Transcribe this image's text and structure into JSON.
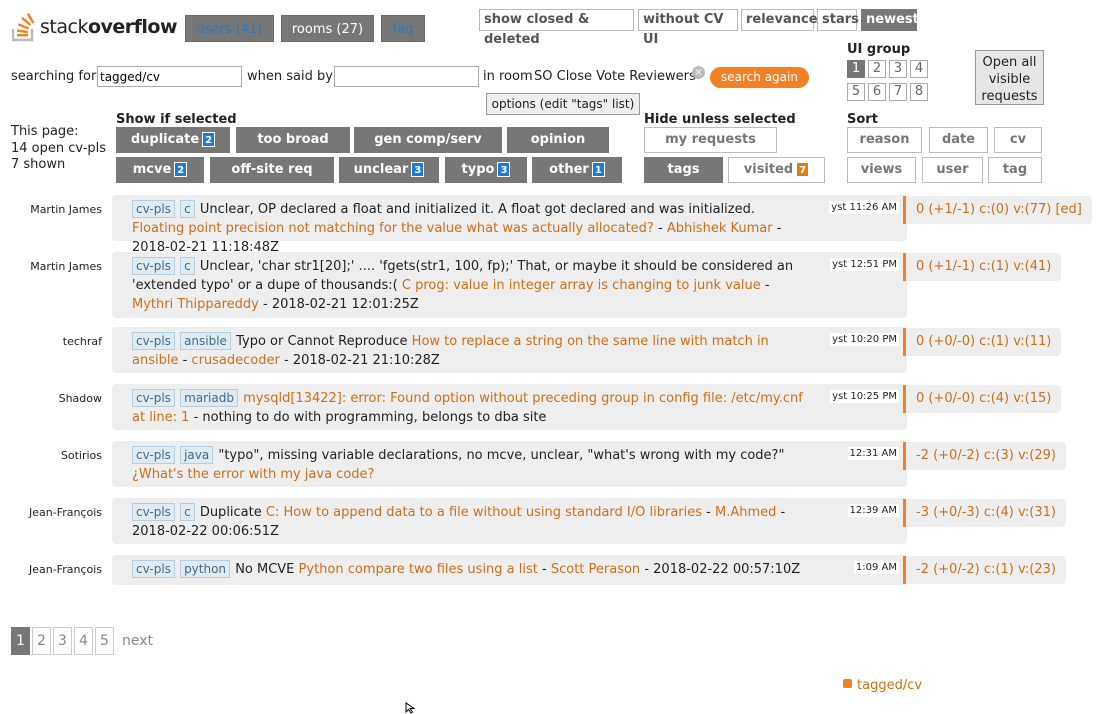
{
  "logo": {
    "text_pre": "stack",
    "text_bold": "overflow"
  },
  "nav": {
    "users": "users (41)",
    "rooms": "rooms (27)",
    "faq": "faq"
  },
  "filters": [
    "show closed & deleted",
    "without CV UI",
    "relevance",
    "stars",
    "newest"
  ],
  "search": {
    "searching_for_label": "searching for",
    "searching_for_value": "tagged/cv",
    "when_said_by_label": "when said by",
    "when_said_by_value": "",
    "in_room_label": "in room",
    "room_name": "SO Close Vote Reviewers",
    "clear": "×",
    "search_again": "search again",
    "options": "options (edit \"tags\" list)"
  },
  "ui_group": {
    "label": "UI group",
    "buttons": [
      "1",
      "2",
      "3",
      "4",
      "5",
      "6",
      "7",
      "8"
    ],
    "active": "1"
  },
  "open_all": "Open all visible requests",
  "this_page": {
    "line1": "This page:",
    "line2": "14 open cv-pls",
    "line3": "7 shown"
  },
  "show_if_selected": {
    "title": "Show if selected",
    "buttons": [
      {
        "label": "duplicate",
        "badge": "2"
      },
      {
        "label": "too broad",
        "badge": ""
      },
      {
        "label": "gen comp/serv",
        "badge": ""
      },
      {
        "label": "opinion",
        "badge": ""
      },
      {
        "label": "mcve",
        "badge": "2"
      },
      {
        "label": "off-site req",
        "badge": ""
      },
      {
        "label": "unclear",
        "badge": "3"
      },
      {
        "label": "typo",
        "badge": "3"
      },
      {
        "label": "other",
        "badge": "1"
      }
    ]
  },
  "hide_unless_selected": {
    "title": "Hide unless selected",
    "my_requests": "my requests",
    "tags": "tags",
    "visited": "visited",
    "visited_badge": "7"
  },
  "sort": {
    "title": "Sort",
    "buttons": [
      "reason",
      "date",
      "cv",
      "views",
      "user",
      "tag"
    ]
  },
  "requests": [
    {
      "user": "Martin James",
      "tags": [
        "cv-pls",
        "c"
      ],
      "text": "Unclear, OP declared a float and initialized it. A float got declared and was initialized.",
      "link": "Floating point precision not matching for the value what was actually allocated?",
      "author": "Abhishek Kumar",
      "date": "2018-02-21 11:18:48Z",
      "time": "yst 11:26 AM",
      "stats": "0 (+1/-1) c:(0) v:(77) [ed]"
    },
    {
      "user": "Martin James",
      "tags": [
        "cv-pls",
        "c"
      ],
      "text": "Unclear, 'char str1[20];' .... 'fgets(str1, 100, fp);' That, or maybe it should be considered an 'extended typo' or a dupe of thousands:(",
      "link": "C prog: value in integer array is changing to junk value",
      "author": "Mythri Thippareddy",
      "date": "2018-02-21 12:01:25Z",
      "time": "yst 12:51 PM",
      "stats": "0 (+1/-1) c:(1) v:(41)"
    },
    {
      "user": "techraf",
      "tags": [
        "cv-pls",
        "ansible"
      ],
      "text": "Typo or Cannot Reproduce",
      "link": "How to replace a string on the same line with match in ansible",
      "author": "crusadecoder",
      "date": "2018-02-21 21:10:28Z",
      "time": "yst 10:20 PM",
      "stats": "0 (+0/-0) c:(1) v:(11)"
    },
    {
      "user": "Shadow",
      "tags": [
        "cv-pls",
        "mariadb"
      ],
      "text": "",
      "link": "mysqld[13422]: error: Found option without preceding group in config file: /etc/my.cnf at line: 1",
      "author": "",
      "date": "",
      "suffix": "nothing to do with programming, belongs to dba site",
      "time": "yst 10:25 PM",
      "stats": "0 (+0/-0) c:(4) v:(15)"
    },
    {
      "user": "Sotirios",
      "tags": [
        "cv-pls",
        "java"
      ],
      "text": "\"typo\", missing variable declarations, no mcve, unclear, \"what's wrong with my code?\"",
      "link": "¿What's the error with my java code?",
      "author": "",
      "date": "",
      "time": "12:31 AM",
      "stats": "-2 (+0/-2) c:(3) v:(29)"
    },
    {
      "user": "Jean-François",
      "tags": [
        "cv-pls",
        "c"
      ],
      "text": "Duplicate",
      "link": "C: How to append data to a file without using standard I/O libraries",
      "author": "M.Ahmed",
      "date": "2018-02-22 00:06:51Z",
      "time": "12:39 AM",
      "stats": "-3 (+0/-3) c:(4) v:(31)"
    },
    {
      "user": "Jean-François",
      "tags": [
        "cv-pls",
        "python"
      ],
      "text": "No MCVE",
      "link": "Python compare two files using a list",
      "author": "Scott Perason",
      "date": "2018-02-22 00:57:10Z",
      "time": "1:09 AM",
      "stats": "-2 (+0/-2) c:(1) v:(23)"
    }
  ],
  "pagination": {
    "pages": [
      "1",
      "2",
      "3",
      "4",
      "5"
    ],
    "active": "1",
    "next": "next"
  },
  "rss": "tagged/cv"
}
